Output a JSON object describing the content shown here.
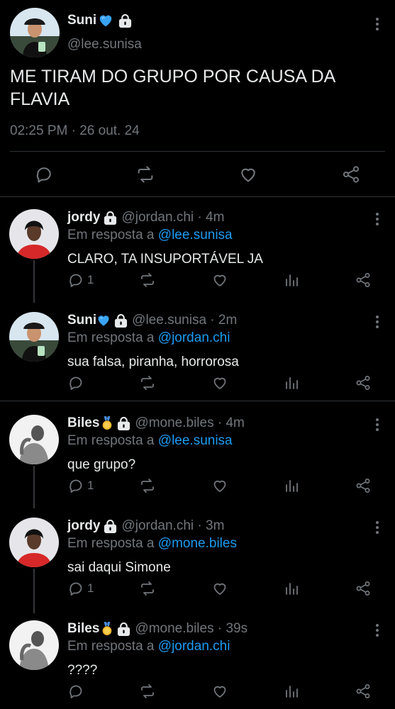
{
  "main_tweet": {
    "name": "Suni",
    "name_emoji": "blue-heart-icon",
    "handle": "@lee.sunisa",
    "text": "ME TIRAM DO GRUPO POR CAUSA DA FLAVIA",
    "timestamp": "02:25 PM · 26 out. 24"
  },
  "replies": [
    {
      "name": "jordy",
      "handle": "@jordan.chi · 4m",
      "reply_prefix": "Em resposta a",
      "reply_to": "@lee.sunisa",
      "text": "CLARO, TA INSUPORTÁVEL JA",
      "reply_count": "1"
    },
    {
      "name": "Suni",
      "handle": "@lee.sunisa · 2m",
      "reply_prefix": "Em resposta a",
      "reply_to": "@jordan.chi",
      "text": "sua falsa, piranha, horrorosa",
      "reply_count": ""
    },
    {
      "name": "Biles",
      "handle": "@mone.biles · 4m",
      "reply_prefix": "Em resposta a",
      "reply_to": "@lee.sunisa",
      "text": "que grupo?",
      "reply_count": "1"
    },
    {
      "name": "jordy",
      "handle": "@jordan.chi · 3m",
      "reply_prefix": "Em resposta a",
      "reply_to": "@mone.biles",
      "text": "sai daqui Simone",
      "reply_count": "1"
    },
    {
      "name": "Biles",
      "handle": "@mone.biles · 39s",
      "reply_prefix": "Em resposta a",
      "reply_to": "@jordan.chi",
      "text": "????",
      "reply_count": ""
    }
  ],
  "colors": {
    "background": "#000000",
    "text": "#e7e9ea",
    "muted": "#71767b",
    "link": "#1d9bf0",
    "divider": "#2f3336"
  }
}
